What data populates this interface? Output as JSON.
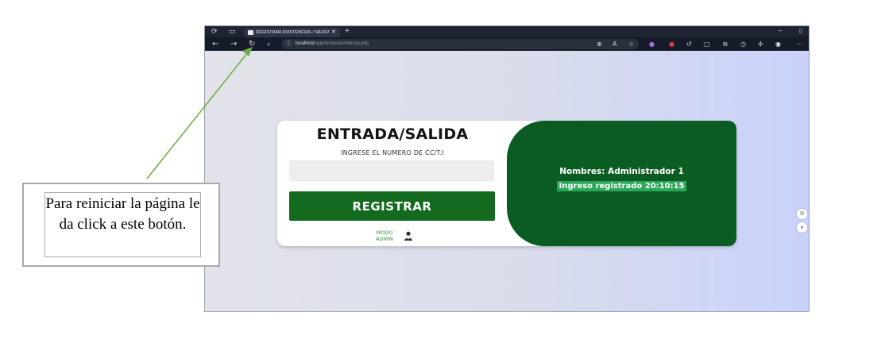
{
  "browser": {
    "tab_title": "REGISTRAR ASISTENCIAS / SALIDA",
    "tab_close": "✕",
    "new_tab": "+",
    "url_host": "localhost",
    "url_path": "/app/vistas/asistencia.php"
  },
  "card": {
    "title": "ENTRADA/SALIDA",
    "input_label": "INGRESE EL NUMERO DE CC/T.I",
    "input_value": "",
    "register_button": "REGISTRAR",
    "admin_mode_line1": "MODO",
    "admin_mode_line2": "ADMIN"
  },
  "result": {
    "nombres": "Nombres: Administrador 1",
    "ingreso": "Ingreso registrado 20:10:15"
  },
  "annotation": {
    "text": "Para reiniciar la página le da click a este botón."
  },
  "colors": {
    "panel_green": "#0a5c23",
    "button_green": "#146a1e",
    "highlight_green": "#2aa85a",
    "arrow_green": "#70ad47"
  }
}
